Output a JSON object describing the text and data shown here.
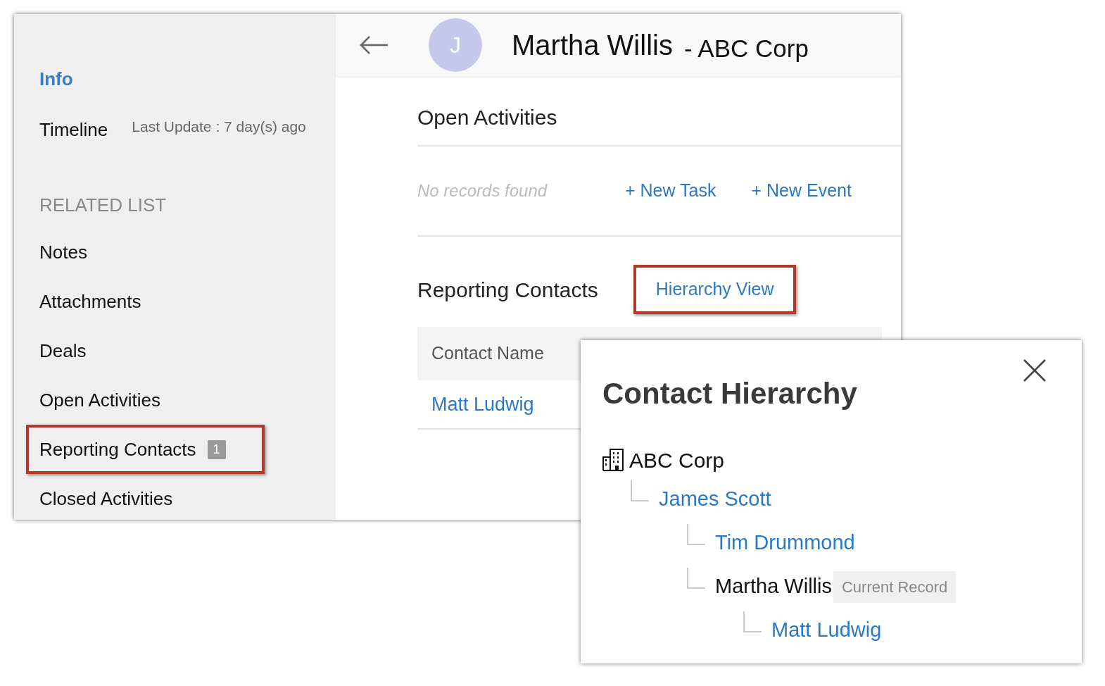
{
  "sidebar": {
    "items": [
      {
        "label": "Info",
        "selected": true
      },
      {
        "label": "Timeline",
        "selected": false,
        "note": "Last Update : 7 day(s) ago"
      }
    ],
    "related_list": {
      "title": "RELATED LIST",
      "items": [
        {
          "label": "Notes",
          "highlighted": false
        },
        {
          "label": "Attachments",
          "highlighted": false
        },
        {
          "label": "Deals",
          "highlighted": false
        },
        {
          "label": "Open Activities",
          "highlighted": false
        },
        {
          "label": "Reporting Contacts",
          "badge": "1",
          "highlighted": true
        },
        {
          "label": "Closed Activities",
          "highlighted": false
        }
      ]
    }
  },
  "header": {
    "avatar": "J",
    "name": "Martha Willis",
    "company": "- ABC Corp"
  },
  "open_activities": {
    "title": "Open Activities",
    "empty_text": "No records found",
    "actions": [
      "+ New Task",
      "+ New Event"
    ]
  },
  "reporting_contacts": {
    "title": "Reporting Contacts",
    "link": {
      "label": "Hierarchy View",
      "highlighted": true
    },
    "table": {
      "columns": [
        "Contact Name"
      ],
      "rows": [
        [
          "Matt Ludwig"
        ]
      ]
    }
  },
  "hierarchy_dialog": {
    "title": "Contact Hierarchy",
    "root": "ABC Corp",
    "children": [
      {
        "name": "James Scott",
        "current": false,
        "children": [
          {
            "name": "Tim Drummond",
            "current": false
          },
          {
            "name": "Martha Willis",
            "current": true,
            "tag": "Current Record",
            "children": [
              {
                "name": "Matt Ludwig",
                "current": false
              }
            ]
          }
        ]
      }
    ]
  }
}
